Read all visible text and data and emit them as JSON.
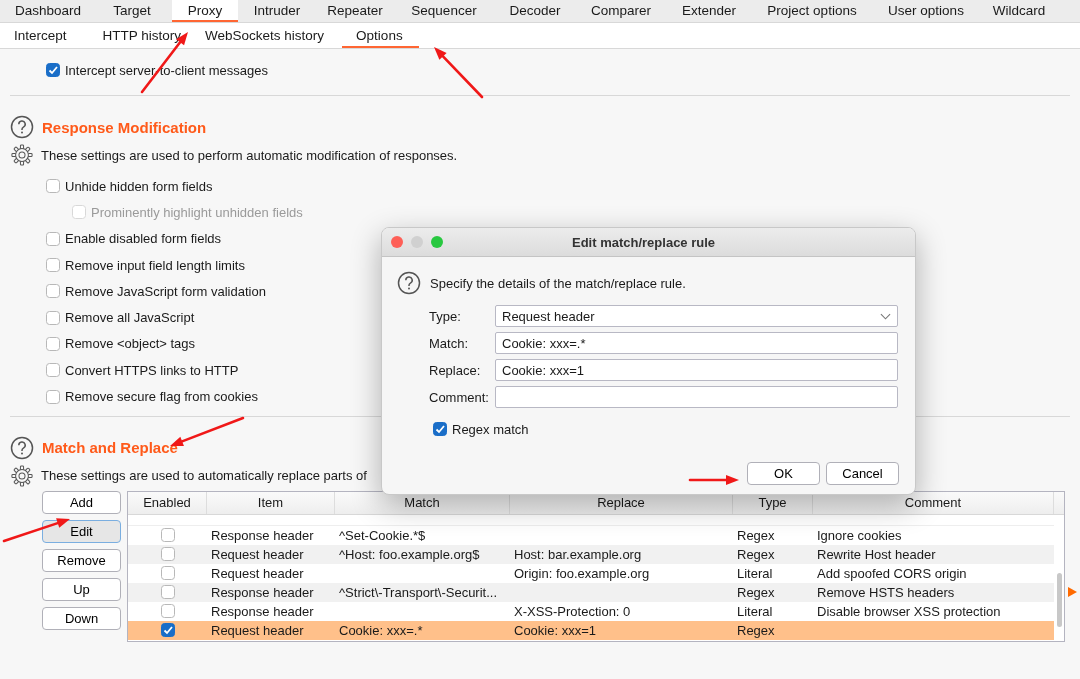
{
  "tabs": [
    {
      "label": "Dashboard",
      "selected": false
    },
    {
      "label": "Target",
      "selected": false
    },
    {
      "label": "Proxy",
      "selected": true
    },
    {
      "label": "Intruder",
      "selected": false
    },
    {
      "label": "Repeater",
      "selected": false
    },
    {
      "label": "Sequencer",
      "selected": false
    },
    {
      "label": "Decoder",
      "selected": false
    },
    {
      "label": "Comparer",
      "selected": false
    },
    {
      "label": "Extender",
      "selected": false
    },
    {
      "label": "Project options",
      "selected": false
    },
    {
      "label": "User options",
      "selected": false
    },
    {
      "label": "Wildcard",
      "selected": false
    }
  ],
  "subtabs": [
    {
      "label": "Intercept",
      "selected": false
    },
    {
      "label": "HTTP history",
      "selected": false
    },
    {
      "label": "WebSockets history",
      "selected": false
    },
    {
      "label": "Options",
      "selected": true
    }
  ],
  "intercept_option": {
    "label": "Intercept server-to-client messages",
    "checked": true
  },
  "response_modification": {
    "title": "Response Modification",
    "description": "These settings are used to perform automatic modification of responses.",
    "options": [
      {
        "label": "Unhide hidden form fields",
        "checked": false,
        "disabled": false,
        "children": [
          {
            "label": "Prominently highlight unhidden fields",
            "checked": false,
            "disabled": true
          }
        ]
      },
      {
        "label": "Enable disabled form fields",
        "checked": false,
        "disabled": false
      },
      {
        "label": "Remove input field length limits",
        "checked": false,
        "disabled": false
      },
      {
        "label": "Remove JavaScript form validation",
        "checked": false,
        "disabled": false
      },
      {
        "label": "Remove all JavaScript",
        "checked": false,
        "disabled": false
      },
      {
        "label": "Remove <object> tags",
        "checked": false,
        "disabled": false
      },
      {
        "label": "Convert HTTPS links to HTTP",
        "checked": false,
        "disabled": false
      },
      {
        "label": "Remove secure flag from cookies",
        "checked": false,
        "disabled": false
      }
    ]
  },
  "match_and_replace": {
    "title": "Match and Replace",
    "description": "These settings are used to automatically replace parts of",
    "buttons": [
      {
        "label": "Add",
        "selected": false
      },
      {
        "label": "Edit",
        "selected": true
      },
      {
        "label": "Remove",
        "selected": false
      },
      {
        "label": "Up",
        "selected": false
      },
      {
        "label": "Down",
        "selected": false
      }
    ],
    "table": {
      "columns": [
        "Enabled",
        "Item",
        "Match",
        "Replace",
        "Type",
        "Comment"
      ],
      "rows": [
        {
          "enabled": false,
          "item": "Response header",
          "match": "^Set-Cookie.*$",
          "type": "Regex",
          "comment": "Ignore cookies",
          "selected": false
        },
        {
          "enabled": false,
          "item": "Request header",
          "match": "^Host: foo.example.org$",
          "replace": "Host: bar.example.org",
          "type": "Regex",
          "comment": "Rewrite Host header",
          "selected": false
        },
        {
          "enabled": false,
          "item": "Request header",
          "replace": "Origin: foo.example.org",
          "type": "Literal",
          "comment": "Add spoofed CORS origin",
          "selected": false
        },
        {
          "enabled": false,
          "item": "Response header",
          "match": "^Strict\\-Transport\\-Securit...",
          "type": "Regex",
          "comment": "Remove HSTS headers",
          "selected": false
        },
        {
          "enabled": false,
          "item": "Response header",
          "replace": "X-XSS-Protection: 0",
          "type": "Literal",
          "comment": "Disable browser XSS protection",
          "selected": false
        },
        {
          "enabled": true,
          "item": "Request header",
          "match": "Cookie: xxx=.*",
          "replace": "Cookie: xxx=1",
          "type": "Regex",
          "selected": true
        }
      ]
    }
  },
  "dialog": {
    "title": "Edit match/replace rule",
    "message": "Specify the details of the match/replace rule.",
    "fields": [
      {
        "label": "Type:",
        "kind": "dropdown",
        "value": "Request header"
      },
      {
        "label": "Match:",
        "kind": "text",
        "value": "Cookie: xxx=.*"
      },
      {
        "label": "Replace:",
        "kind": "text",
        "value": "Cookie: xxx=1"
      },
      {
        "label": "Comment:",
        "kind": "text"
      }
    ],
    "regex_match": {
      "label": "Regex match",
      "checked": true
    },
    "buttons": [
      "OK",
      "Cancel"
    ]
  }
}
